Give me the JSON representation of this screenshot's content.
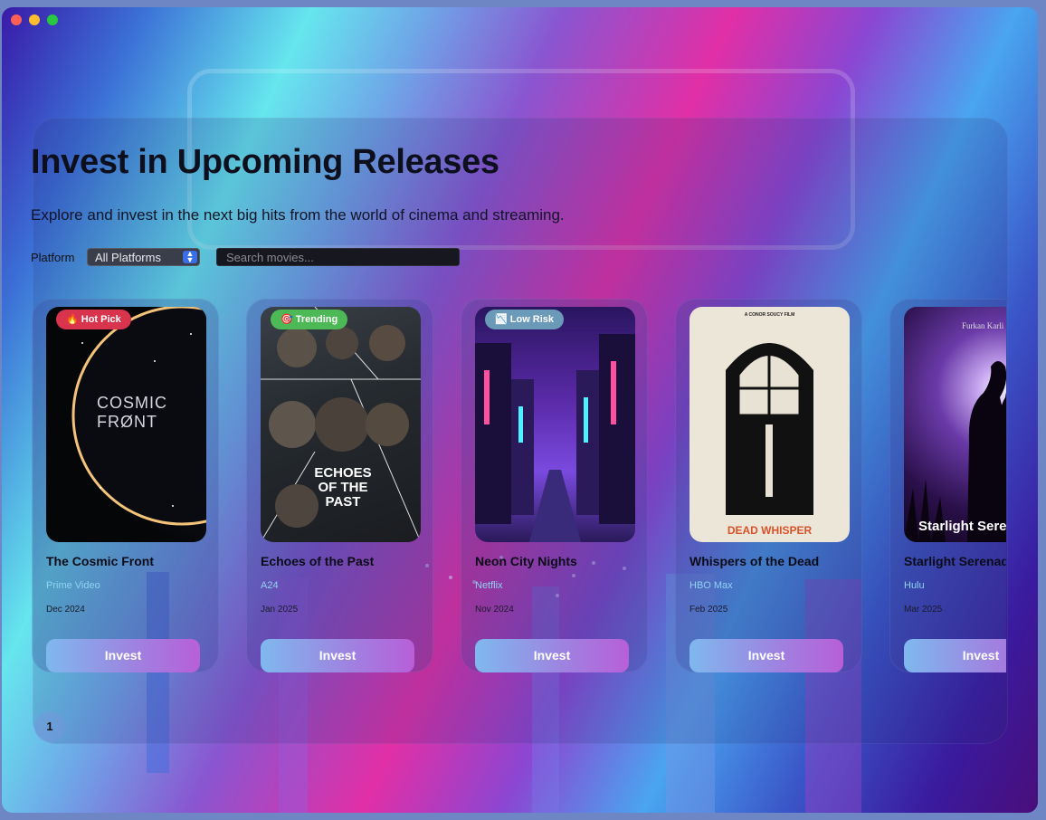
{
  "header": {
    "title": "Invest in Upcoming Releases",
    "subtitle": "Explore and invest in the next big hits from the world of cinema and streaming."
  },
  "filters": {
    "platform_label": "Platform",
    "platform_value": "All Platforms",
    "search_placeholder": "Search movies..."
  },
  "movies": [
    {
      "badge": "🔥 Hot Pick",
      "badge_color": "#d9344d",
      "title": "The Cosmic Front",
      "platform": "Prime Video",
      "date": "Dec 2024",
      "poster_text": "COSMIC FRØNT",
      "action": "Invest"
    },
    {
      "badge": "🎯 Trending",
      "badge_color": "#4db856",
      "title": "Echoes of the Past",
      "platform": "A24",
      "date": "Jan 2025",
      "poster_text": "ECHOES OF THE PAST",
      "action": "Invest"
    },
    {
      "badge": "📉 Low Risk",
      "badge_color": "#6a9ab8",
      "title": "Neon City Nights",
      "platform": "Netflix",
      "date": "Nov 2024",
      "poster_text": "",
      "action": "Invest"
    },
    {
      "badge": "",
      "badge_color": "",
      "title": "Whispers of the Dead",
      "platform": "HBO Max",
      "date": "Feb 2025",
      "poster_text": "DEAD WHISPER",
      "poster_top": "A CONOR SOUCY FILM",
      "action": "Invest"
    },
    {
      "badge": "",
      "badge_color": "",
      "title": "Starlight Serenade",
      "platform": "Hulu",
      "date": "Mar 2025",
      "poster_text": "Starlight Serenade",
      "poster_top": "Furkan Karli",
      "action": "Invest"
    }
  ],
  "pagination": {
    "current": "1"
  },
  "colors": {
    "accent": "#3b6fe8",
    "invest_gradient_start": "#7fb8ee",
    "invest_gradient_end": "#b85fd8"
  }
}
